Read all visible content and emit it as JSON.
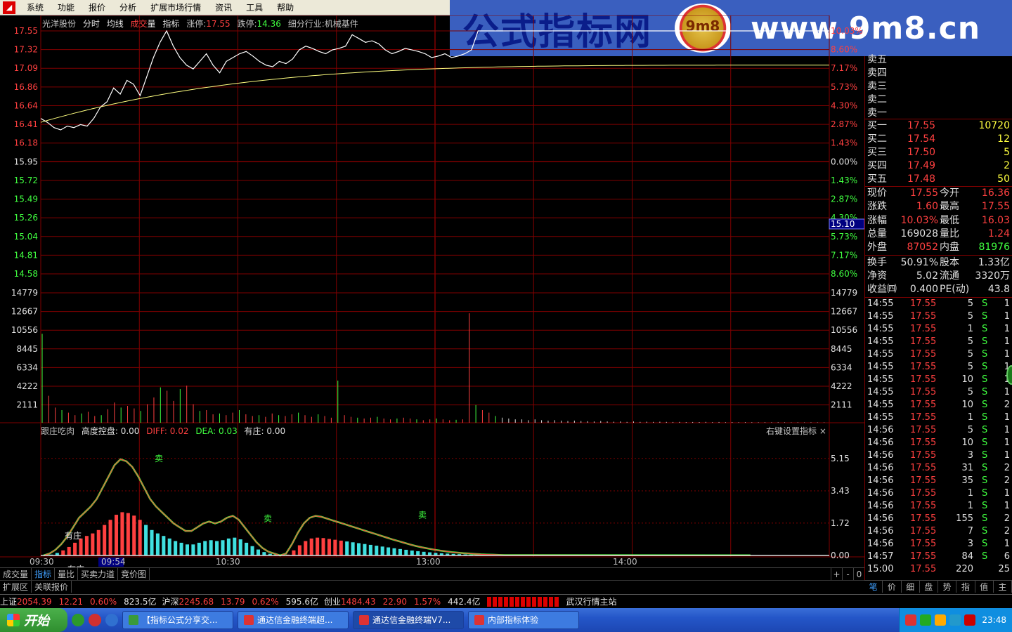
{
  "menu": [
    "系统",
    "功能",
    "报价",
    "分析",
    "扩展市场行情",
    "资讯",
    "工具",
    "帮助"
  ],
  "banner": {
    "left": "公式指标网",
    "coin": "9m8",
    "right": "www.9m8.cn"
  },
  "chart_title": {
    "stock_name": "光洋股份",
    "items": [
      "分时",
      "均线"
    ],
    "volume_label_1": "成交",
    "volume_label_2": "量",
    "indicator": "指标",
    "limit_up_label": "涨停:",
    "limit_up": "17.55",
    "limit_down_label": "跌停:",
    "limit_down": "14.36",
    "industry": "细分行业:机械基件"
  },
  "indicator_title": {
    "name": "跟庄吃肉",
    "h_label": "高度控盘: 0.00",
    "diff": "DIFF: 0.02",
    "dea": "DEA: 0.03",
    "zhuang": "有庄: 0.00"
  },
  "indicator_settings": "右键设置指标 ×",
  "chart_data": {
    "type": "line",
    "price_axis": [
      "17.55",
      "17.32",
      "17.09",
      "16.86",
      "16.64",
      "16.41",
      "16.18",
      "15.95",
      "15.72",
      "15.49",
      "15.26",
      "15.04",
      "14.81",
      "14.58"
    ],
    "pct_axis": [
      "10.03%",
      "8.60%",
      "7.17%",
      "5.73%",
      "4.30%",
      "2.87%",
      "1.43%",
      "0.00%",
      "1.43%",
      "2.87%",
      "4.30%",
      "5.73%",
      "7.17%",
      "8.60%"
    ],
    "volume_axis": [
      "14779",
      "12667",
      "10556",
      "8445",
      "6334",
      "4222",
      "2111"
    ],
    "indicator_axis": [
      "5.15",
      "3.43",
      "1.72",
      "0.00"
    ],
    "time_labels": [
      "09:30",
      "09:54",
      "10:30",
      "13:00",
      "14:00"
    ],
    "cursor_price": "15.10",
    "price_range": [
      14.36,
      17.55
    ],
    "prev_close": 15.95,
    "price_series": [
      16.4,
      16.35,
      16.28,
      16.25,
      16.3,
      16.28,
      16.32,
      16.3,
      16.4,
      16.55,
      16.62,
      16.8,
      16.72,
      16.9,
      16.85,
      16.7,
      16.95,
      17.2,
      17.4,
      17.55,
      17.35,
      17.2,
      17.1,
      17.05,
      17.15,
      17.25,
      17.1,
      17.0,
      17.15,
      17.2,
      17.25,
      17.28,
      17.22,
      17.15,
      17.1,
      17.08,
      17.15,
      17.12,
      17.18,
      17.3,
      17.35,
      17.32,
      17.28,
      17.25,
      17.3,
      17.32,
      17.35,
      17.5,
      17.45,
      17.4,
      17.42,
      17.38,
      17.3,
      17.25,
      17.28,
      17.32,
      17.3,
      17.28,
      17.25,
      17.2,
      17.22,
      17.25,
      17.2,
      17.22,
      17.25,
      17.3,
      17.55,
      17.55,
      17.55,
      17.55,
      17.55,
      17.55,
      17.55,
      17.55,
      17.55,
      17.55,
      17.55,
      17.55,
      17.55,
      17.55,
      17.55,
      17.55,
      17.55,
      17.55,
      17.55,
      17.55,
      17.55,
      17.55,
      17.55,
      17.55,
      17.55,
      17.55,
      17.55,
      17.55,
      17.55,
      17.55,
      17.55,
      17.55,
      17.55,
      17.55,
      17.55,
      17.55,
      17.55,
      17.55,
      17.55,
      17.55,
      17.55,
      17.55,
      17.55,
      17.55,
      17.55,
      17.55,
      17.55,
      17.55,
      17.55,
      17.55,
      17.55,
      17.55,
      17.55,
      17.55
    ],
    "avg_series_start": 16.35,
    "avg_series_end": 17.1,
    "volume_series": [
      10556,
      3200,
      1800,
      1500,
      1200,
      900,
      1100,
      1300,
      800,
      900,
      1600,
      2400,
      1800,
      2000,
      1700,
      1400,
      2200,
      3000,
      4200,
      3800,
      2600,
      4000,
      4400,
      2200,
      1400,
      1500,
      1000,
      1100,
      900,
      1200,
      1500,
      1000,
      800,
      900,
      700,
      1100,
      900,
      800,
      1000,
      1200,
      900,
      700,
      1000,
      800,
      600,
      5000,
      900,
      700,
      600,
      500,
      600,
      700,
      500,
      400,
      500,
      600,
      500,
      400,
      300,
      400,
      500,
      400,
      300,
      350,
      400,
      13000,
      2100,
      1500,
      1200,
      800,
      600,
      500,
      400,
      400,
      300,
      400,
      300,
      250,
      300,
      250,
      200,
      250,
      200,
      180,
      150,
      200,
      150,
      120,
      150,
      100,
      150,
      100,
      120,
      100,
      120,
      100,
      90,
      100,
      80,
      90,
      80,
      100,
      70,
      90,
      60,
      80,
      60,
      70,
      60,
      50,
      60,
      50,
      60,
      50,
      40,
      50,
      40,
      50,
      40,
      40
    ],
    "indicator_series": [
      0.0,
      0.1,
      0.3,
      0.6,
      1.0,
      1.5,
      2.0,
      2.3,
      2.6,
      3.0,
      3.6,
      4.2,
      4.8,
      5.1,
      5.0,
      4.7,
      4.2,
      3.6,
      3.0,
      2.6,
      2.3,
      2.0,
      1.7,
      1.5,
      1.3,
      1.3,
      1.5,
      1.7,
      1.8,
      1.7,
      1.8,
      2.0,
      2.1,
      1.9,
      1.5,
      1.1,
      0.7,
      0.4,
      0.2,
      0.1,
      0.0,
      0.1,
      0.6,
      1.2,
      1.7,
      2.0,
      2.1,
      2.05,
      1.95,
      1.85,
      1.75,
      1.65,
      1.55,
      1.45,
      1.35,
      1.25,
      1.15,
      1.05,
      0.95,
      0.85,
      0.76,
      0.67,
      0.58,
      0.5,
      0.43,
      0.37,
      0.31,
      0.26,
      0.22,
      0.18,
      0.15,
      0.12,
      0.1,
      0.08,
      0.06,
      0.05,
      0.04,
      0.03,
      0.02,
      0.02
    ],
    "annotations": [
      "有庄",
      "有庄",
      "卖",
      "卖",
      "卖"
    ]
  },
  "bottom_tabs": [
    "成交量",
    "指标",
    "量比",
    "买卖力道",
    "竞价图"
  ],
  "bottom_controls": [
    "+",
    "-",
    "0"
  ],
  "sub_tabs": [
    "扩展区",
    "关联报价"
  ],
  "order_book": {
    "sell_labels": [
      "卖五",
      "卖四",
      "卖三",
      "卖二",
      "卖一"
    ],
    "buy": [
      {
        "label": "买一",
        "price": "17.55",
        "vol": "10720"
      },
      {
        "label": "买二",
        "price": "17.54",
        "vol": "12"
      },
      {
        "label": "买三",
        "price": "17.50",
        "vol": "5"
      },
      {
        "label": "买四",
        "price": "17.49",
        "vol": "2"
      },
      {
        "label": "买五",
        "price": "17.48",
        "vol": "50"
      }
    ]
  },
  "quote": [
    {
      "l1": "现价",
      "v1": "17.55",
      "c1": "red",
      "l2": "今开",
      "v2": "16.36",
      "c2": "red"
    },
    {
      "l1": "涨跌",
      "v1": "1.60",
      "c1": "red",
      "l2": "最高",
      "v2": "17.55",
      "c2": "red"
    },
    {
      "l1": "涨幅",
      "v1": "10.03%",
      "c1": "red",
      "l2": "最低",
      "v2": "16.03",
      "c2": "red"
    },
    {
      "l1": "总量",
      "v1": "169028",
      "c1": "white",
      "l2": "量比",
      "v2": "1.24",
      "c2": "red"
    },
    {
      "l1": "外盘",
      "v1": "87052",
      "c1": "red",
      "l2": "内盘",
      "v2": "81976",
      "c2": "green"
    },
    {
      "l1": "换手",
      "v1": "50.91%",
      "c1": "white",
      "l2": "股本",
      "v2": "1.33亿",
      "c2": "white"
    },
    {
      "l1": "净资",
      "v1": "5.02",
      "c1": "white",
      "l2": "流通",
      "v2": "3320万",
      "c2": "white"
    },
    {
      "l1": "收益㈣",
      "v1": "0.400",
      "c1": "white",
      "l2": "PE(动)",
      "v2": "43.8",
      "c2": "white"
    }
  ],
  "ticks": [
    {
      "t": "14:55",
      "p": "17.55",
      "v": "5",
      "s": "S",
      "n": "1"
    },
    {
      "t": "14:55",
      "p": "17.55",
      "v": "5",
      "s": "S",
      "n": "1"
    },
    {
      "t": "14:55",
      "p": "17.55",
      "v": "1",
      "s": "S",
      "n": "1"
    },
    {
      "t": "14:55",
      "p": "17.55",
      "v": "5",
      "s": "S",
      "n": "1"
    },
    {
      "t": "14:55",
      "p": "17.55",
      "v": "5",
      "s": "S",
      "n": "1"
    },
    {
      "t": "14:55",
      "p": "17.55",
      "v": "5",
      "s": "S",
      "n": "1"
    },
    {
      "t": "14:55",
      "p": "17.55",
      "v": "10",
      "s": "S",
      "n": "1"
    },
    {
      "t": "14:55",
      "p": "17.55",
      "v": "5",
      "s": "S",
      "n": "1"
    },
    {
      "t": "14:55",
      "p": "17.55",
      "v": "10",
      "s": "S",
      "n": "2"
    },
    {
      "t": "14:55",
      "p": "17.55",
      "v": "1",
      "s": "S",
      "n": "1"
    },
    {
      "t": "14:56",
      "p": "17.55",
      "v": "5",
      "s": "S",
      "n": "1"
    },
    {
      "t": "14:56",
      "p": "17.55",
      "v": "10",
      "s": "S",
      "n": "1"
    },
    {
      "t": "14:56",
      "p": "17.55",
      "v": "3",
      "s": "S",
      "n": "1"
    },
    {
      "t": "14:56",
      "p": "17.55",
      "v": "31",
      "s": "S",
      "n": "2"
    },
    {
      "t": "14:56",
      "p": "17.55",
      "v": "35",
      "s": "S",
      "n": "2"
    },
    {
      "t": "14:56",
      "p": "17.55",
      "v": "1",
      "s": "S",
      "n": "1"
    },
    {
      "t": "14:56",
      "p": "17.55",
      "v": "1",
      "s": "S",
      "n": "1"
    },
    {
      "t": "14:56",
      "p": "17.55",
      "v": "155",
      "s": "S",
      "n": "2"
    },
    {
      "t": "14:56",
      "p": "17.55",
      "v": "7",
      "s": "S",
      "n": "2"
    },
    {
      "t": "14:56",
      "p": "17.55",
      "v": "3",
      "s": "S",
      "n": "1"
    },
    {
      "t": "14:57",
      "p": "17.55",
      "v": "84",
      "s": "S",
      "n": "6"
    },
    {
      "t": "15:00",
      "p": "17.55",
      "v": "220",
      "s": "",
      "n": "25"
    }
  ],
  "rp_tabs": [
    "笔",
    "价",
    "细",
    "盘",
    "势",
    "指",
    "值",
    "主"
  ],
  "status": {
    "sh_label": "上证",
    "sh_val": "2054.39",
    "sh_chg": "12.21",
    "sh_pct": "0.60%",
    "sh_amt": "823.5亿",
    "sz_label": "沪深",
    "sz_val": "2245.68",
    "sz_chg": "13.79",
    "sz_pct": "0.62%",
    "sz_amt": "595.6亿",
    "cy_label": "创业",
    "cy_val": "1484.43",
    "cy_chg": "22.90",
    "cy_pct": "1.57%",
    "cy_amt": "442.4亿",
    "server": "武汉行情主站"
  },
  "taskbar": {
    "start": "开始",
    "tasks": [
      "【指标公式分享交...",
      "通达信金融终端超...",
      "通达信金融终端V7...",
      "内部指标体验"
    ],
    "clock": "23:48"
  }
}
